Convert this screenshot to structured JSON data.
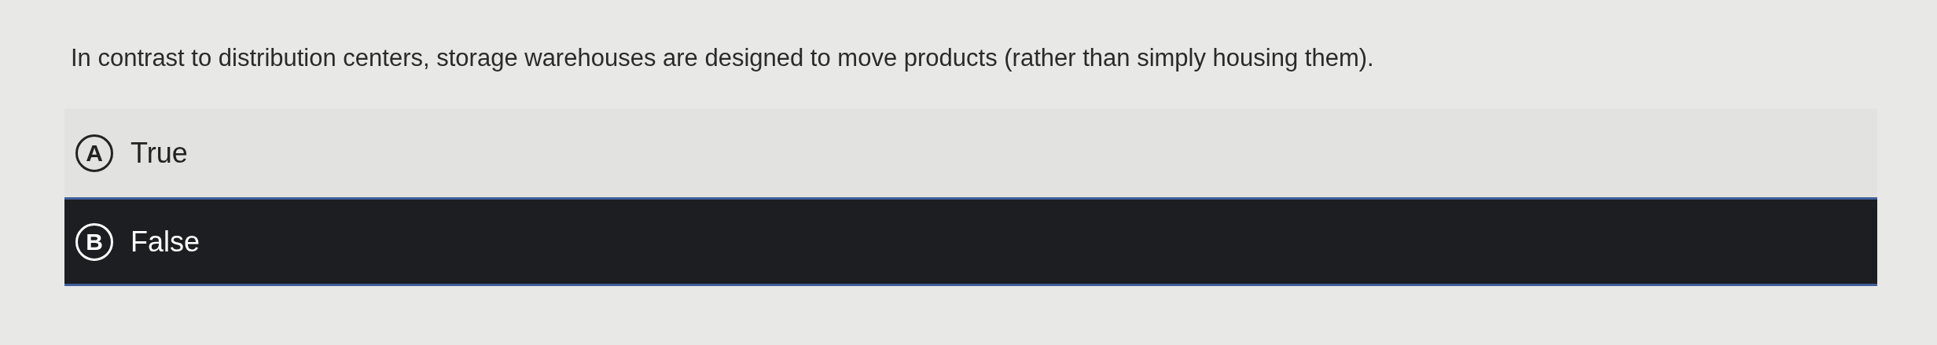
{
  "question": "In contrast to distribution centers, storage warehouses are designed to move products (rather than simply housing them).",
  "options": [
    {
      "letter": "A",
      "label": "True",
      "selected": false
    },
    {
      "letter": "B",
      "label": "False",
      "selected": true
    }
  ]
}
